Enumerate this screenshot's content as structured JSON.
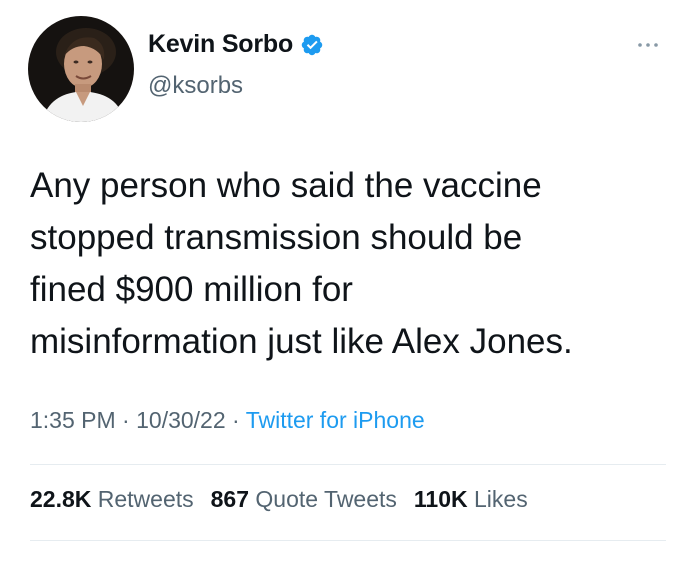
{
  "author": {
    "display_name": "Kevin Sorbo",
    "handle": "@ksorbs",
    "verified": true
  },
  "tweet": {
    "text": "Any person who said the vaccine\nstopped transmission should be\nfined $900 million for\nmisinformation just like Alex Jones.",
    "time": "1:35 PM",
    "date": "10/30/22",
    "separator": "·",
    "source": "Twitter for iPhone"
  },
  "stats": {
    "retweets": {
      "count": "22.8K",
      "label": "Retweets"
    },
    "quote_tweets": {
      "count": "867",
      "label": "Quote Tweets"
    },
    "likes": {
      "count": "110K",
      "label": "Likes"
    }
  },
  "icons": {
    "verified": "verified-badge-icon",
    "more": "more-options-icon"
  },
  "colors": {
    "accent": "#1d9bf0",
    "text_primary": "#0f1419",
    "text_secondary": "#536471",
    "divider": "#e6ecf0"
  }
}
